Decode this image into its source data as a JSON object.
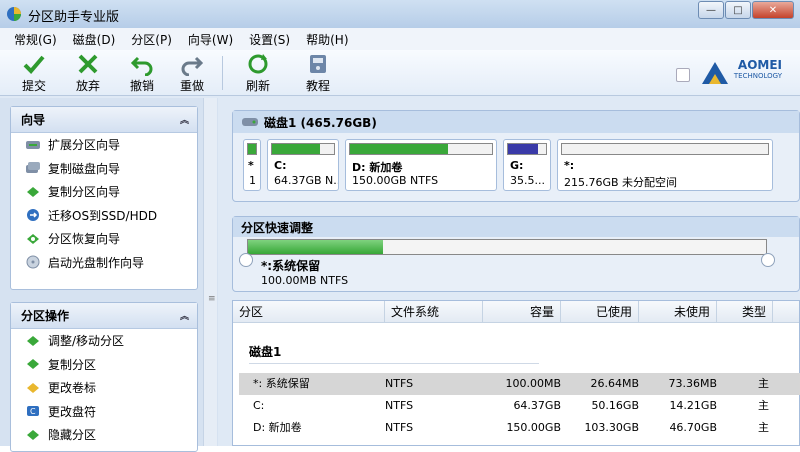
{
  "window": {
    "title": "分区助手专业版",
    "controls": {
      "minimize": "—",
      "maximize": "□",
      "close": "✕"
    }
  },
  "menu": [
    "常规(G)",
    "磁盘(D)",
    "分区(P)",
    "向导(W)",
    "设置(S)",
    "帮助(H)"
  ],
  "toolbar": {
    "commit": "提交",
    "discard": "放弃",
    "undo": "撤销",
    "redo": "重做",
    "refresh": "刷新",
    "tutorial": "教程",
    "logo_line1": "AOMEI",
    "logo_line2": "TECHNOLOGY"
  },
  "wizard_panel": {
    "title": "向导",
    "collapse_glyph": "︽",
    "items": [
      "扩展分区向导",
      "复制磁盘向导",
      "复制分区向导",
      "迁移OS到SSD/HDD",
      "分区恢复向导",
      "启动光盘制作向导"
    ]
  },
  "ops_panel": {
    "title": "分区操作",
    "collapse_glyph": "︽",
    "items": [
      "调整/移动分区",
      "复制分区",
      "更改卷标",
      "更改盘符",
      "隐藏分区"
    ]
  },
  "splitter_grip": "≡",
  "disk": {
    "title": "磁盘1 (465.76GB)",
    "partitions": [
      {
        "label": "*",
        "info": "1",
        "used_pct": 100,
        "color": "#3aa83a"
      },
      {
        "label": "C:",
        "info": "64.37GB N...",
        "used_pct": 78,
        "color": "#3aa83a"
      },
      {
        "label": "D: 新加卷",
        "info": "150.00GB NTFS",
        "used_pct": 69,
        "color": "#3aa83a"
      },
      {
        "label": "G:",
        "info": "35.5...",
        "used_pct": 78,
        "color": "#3a3aa8"
      },
      {
        "label": "*:",
        "info": "215.76GB 未分配空间",
        "used_pct": 0,
        "color": "#3aa83a"
      }
    ]
  },
  "quick_adjust": {
    "title": "分区快速调整",
    "label": "*:系统保留",
    "info": "100.00MB NTFS"
  },
  "table": {
    "headers": [
      "分区",
      "文件系统",
      "容量",
      "已使用",
      "未使用",
      "类型"
    ],
    "group": "磁盘1",
    "rows": [
      {
        "name": "*: 系统保留",
        "fs": "NTFS",
        "cap": "100.00MB",
        "used": "26.64MB",
        "free": "73.36MB",
        "type": "主"
      },
      {
        "name": "C:",
        "fs": "NTFS",
        "cap": "64.37GB",
        "used": "50.16GB",
        "free": "14.21GB",
        "type": "主"
      },
      {
        "name": "D: 新加卷",
        "fs": "NTFS",
        "cap": "150.00GB",
        "used": "103.30GB",
        "free": "46.70GB",
        "type": "主"
      }
    ]
  }
}
